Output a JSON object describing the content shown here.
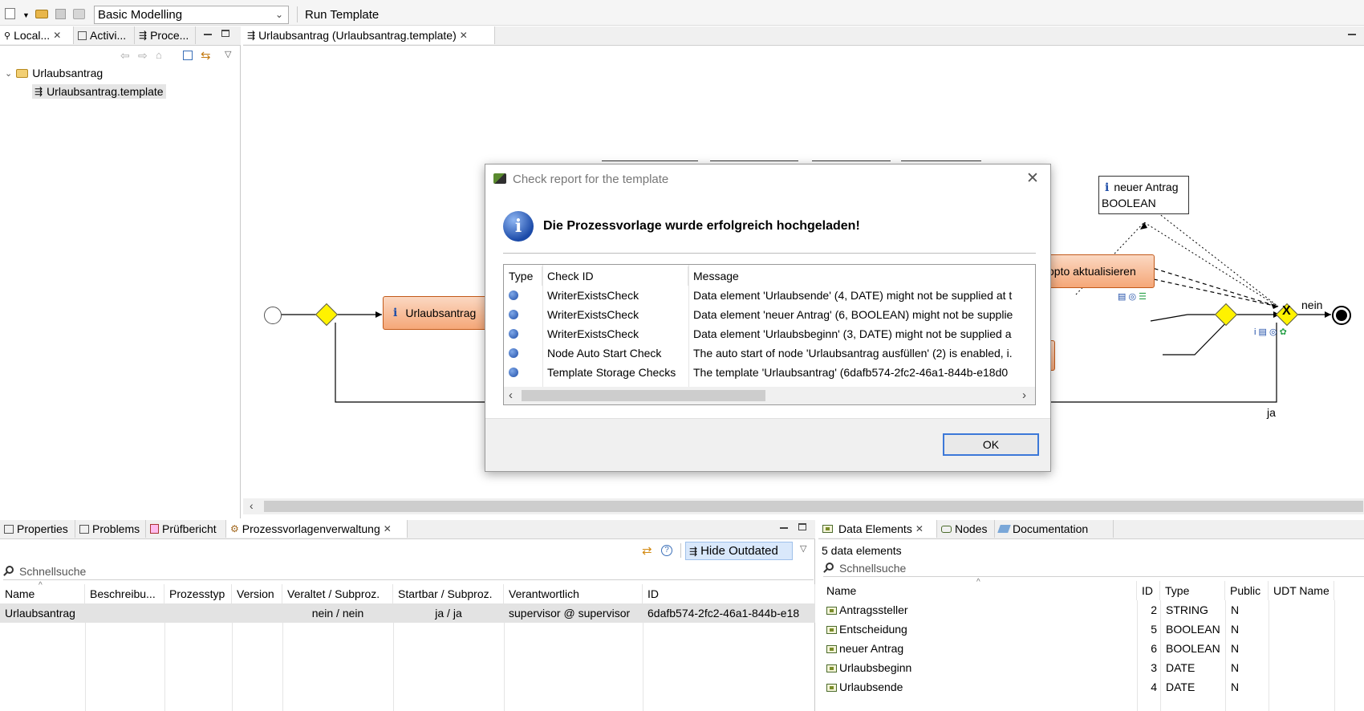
{
  "toolbar": {
    "perspective_value": "Basic Modelling",
    "run_template_label": "Run Template"
  },
  "left_panel": {
    "tabs": [
      {
        "label": "Local..."
      },
      {
        "label": "Activi..."
      },
      {
        "label": "Proce..."
      }
    ],
    "tree": {
      "folder": "Urlaubsantrag",
      "file": "Urlaubsantrag.template"
    }
  },
  "editor": {
    "tab_label": "Urlaubsantrag (Urlaubsantrag.template)",
    "activity_1": "Urlaubsantrag",
    "activity_2": "opto aktualisieren",
    "data_note_line1": "neuer Antrag",
    "data_note_line2": "BOOLEAN",
    "edge_no_label": "nein",
    "edge_yes_label": "ja",
    "info_glyph": "i"
  },
  "dialog": {
    "title": "Check report for the template",
    "message": "Die Prozessvorlage wurde erfolgreich hochgeladen!",
    "columns": [
      "Type",
      "Check ID",
      "Message"
    ],
    "rows": [
      {
        "check_id": "WriterExistsCheck",
        "message": "Data element 'Urlaubsende' (4, DATE) might not be supplied at t"
      },
      {
        "check_id": "WriterExistsCheck",
        "message": "Data element 'neuer Antrag' (6, BOOLEAN) might not be supplie"
      },
      {
        "check_id": "WriterExistsCheck",
        "message": "Data element 'Urlaubsbeginn' (3, DATE) might not be supplied a"
      },
      {
        "check_id": "Node Auto Start Check",
        "message": "The auto start of node 'Urlaubsantrag ausfüllen' (2) is enabled, i."
      },
      {
        "check_id": "Template Storage Checks",
        "message": "The template 'Urlaubsantrag' (6dafb574-2fc2-46a1-844b-e18d0"
      }
    ],
    "ok_label": "OK"
  },
  "bottom_left": {
    "tabs": [
      {
        "label": "Properties"
      },
      {
        "label": "Problems"
      },
      {
        "label": "Prüfbericht"
      },
      {
        "label": "Prozessvorlagenverwaltung"
      }
    ],
    "hide_outdated_label": "Hide Outdated",
    "search_placeholder": "Schnellsuche",
    "columns": [
      "Name",
      "Beschreibu...",
      "Prozesstyp",
      "Version",
      "Veraltet / Subproz.",
      "Startbar / Subproz.",
      "Verantwortlich",
      "ID"
    ],
    "rows": [
      {
        "name": "Urlaubsantrag",
        "beschreibung": "",
        "prozesstyp": "",
        "version": "",
        "veraltet": "nein / nein",
        "startbar": "ja / ja",
        "verantwortlich": "supervisor @ supervisor",
        "id": "6dafb574-2fc2-46a1-844b-e18"
      }
    ]
  },
  "bottom_right": {
    "tabs": [
      {
        "label": "Data Elements"
      },
      {
        "label": "Nodes"
      },
      {
        "label": "Documentation"
      }
    ],
    "count_label": "5 data elements",
    "search_placeholder": "Schnellsuche",
    "columns": [
      "Name",
      "ID",
      "Type",
      "Public",
      "UDT Name"
    ],
    "rows": [
      {
        "name": "Antragssteller",
        "id": "2",
        "type": "STRING",
        "public": "N"
      },
      {
        "name": "Entscheidung",
        "id": "5",
        "type": "BOOLEAN",
        "public": "N"
      },
      {
        "name": "neuer Antrag",
        "id": "6",
        "type": "BOOLEAN",
        "public": "N"
      },
      {
        "name": "Urlaubsbeginn",
        "id": "3",
        "type": "DATE",
        "public": "N"
      },
      {
        "name": "Urlaubsende",
        "id": "4",
        "type": "DATE",
        "public": "N"
      }
    ]
  },
  "colors": {
    "accent": "#3c78d8",
    "info_blue": "#1f4ea8",
    "activity_fill": "#f5a778",
    "gateway_yellow": "#fff200"
  }
}
